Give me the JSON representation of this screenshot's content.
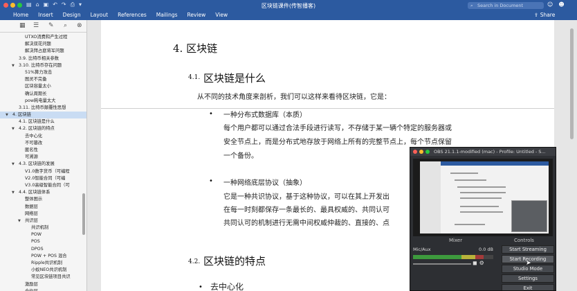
{
  "window": {
    "title": "区块链课件(传智播客)",
    "search_placeholder": "Search in Document",
    "toolbar_icons": [
      "sidebar-icon",
      "home-icon",
      "save-icon",
      "undo-icon",
      "redo-icon",
      "print-icon",
      "more-icon"
    ]
  },
  "ribbon": {
    "tabs": [
      "Home",
      "Insert",
      "Design",
      "Layout",
      "References",
      "Mailings",
      "Review",
      "View"
    ],
    "share": "Share"
  },
  "navigation": {
    "items": [
      {
        "text": "UTXO消费和产生过程",
        "indent": 36,
        "caret": ""
      },
      {
        "text": "解决双花问题",
        "indent": 36,
        "caret": ""
      },
      {
        "text": "解决拜占庭将军问题",
        "indent": 36,
        "caret": ""
      },
      {
        "text": "3.9. 比特币相关参数",
        "indent": 27,
        "caret": ""
      },
      {
        "text": "3.10. 比特币存在问题",
        "indent": 27,
        "caret": "▼"
      },
      {
        "text": "51%算力攻击",
        "indent": 36,
        "caret": ""
      },
      {
        "text": "图灵不完备",
        "indent": 36,
        "caret": ""
      },
      {
        "text": "区块容量太小",
        "indent": 36,
        "caret": ""
      },
      {
        "text": "确认周期长",
        "indent": 36,
        "caret": ""
      },
      {
        "text": "pow耗电量太大",
        "indent": 36,
        "caret": ""
      },
      {
        "text": "3.11. 比特币颠覆性思想",
        "indent": 27,
        "caret": ""
      },
      {
        "text": "4. 区块链",
        "indent": 18,
        "caret": "▼",
        "selected": true
      },
      {
        "text": "4.1. 区块链是什么",
        "indent": 27,
        "caret": ""
      },
      {
        "text": "4.2. 区块链的特点",
        "indent": 27,
        "caret": "▼"
      },
      {
        "text": "去中心化",
        "indent": 36,
        "caret": ""
      },
      {
        "text": "不可篡改",
        "indent": 36,
        "caret": ""
      },
      {
        "text": "匿名性",
        "indent": 36,
        "caret": ""
      },
      {
        "text": "可溯源",
        "indent": 36,
        "caret": ""
      },
      {
        "text": "4.3. 区块链的发展",
        "indent": 27,
        "caret": "▼"
      },
      {
        "text": "V1.0数字货币（可编程",
        "indent": 36,
        "caret": ""
      },
      {
        "text": "V2.0智能合同（可编",
        "indent": 36,
        "caret": ""
      },
      {
        "text": "V3.0高级智能合同（可",
        "indent": 36,
        "caret": ""
      },
      {
        "text": "4.4. 区块链体系",
        "indent": 27,
        "caret": "▼"
      },
      {
        "text": "整体图示",
        "indent": 36,
        "caret": ""
      },
      {
        "text": "数据层",
        "indent": 36,
        "caret": ""
      },
      {
        "text": "网络层",
        "indent": 36,
        "caret": ""
      },
      {
        "text": "共识层",
        "indent": 36,
        "caret": "▼"
      },
      {
        "text": "共识机制",
        "indent": 45,
        "caret": ""
      },
      {
        "text": "POW",
        "indent": 45,
        "caret": ""
      },
      {
        "text": "POS",
        "indent": 45,
        "caret": ""
      },
      {
        "text": "DPOS",
        "indent": 45,
        "caret": ""
      },
      {
        "text": "POW + POS 混合",
        "indent": 45,
        "caret": ""
      },
      {
        "text": "Ripple共识机制",
        "indent": 45,
        "caret": ""
      },
      {
        "text": "小蚁NEO共识机制",
        "indent": 45,
        "caret": ""
      },
      {
        "text": "常见区块链项目共识",
        "indent": 45,
        "caret": ""
      },
      {
        "text": "激励层",
        "indent": 36,
        "caret": ""
      },
      {
        "text": "合约层",
        "indent": 36,
        "caret": ""
      }
    ]
  },
  "document": {
    "h_chapter": "4.  区块链",
    "h_41_num": "4.1.",
    "h_41_text": "区块链是什么",
    "intro": "从不同的技术角度来剖析，我们可以这样来看待区块链，它是：",
    "b1_title": "一种分布式数据库（本质）",
    "b1_line1": "每个用户都可以通过合法手段进行读写，不存储于某一辆个特定的服务器或",
    "b1_line2": "安全节点上，而是分布式地存放于网络上所有的完整节点上，每个节点保留",
    "b1_line3": "一个备份。",
    "b2_title": "一种网络底层协议（抽象）",
    "b2_line1": "它是一种共识协议，基于这种协议，可以在其上开发出",
    "b2_line2": "在每一时刻都保存一条最长的、最具权威的、共同认可",
    "b2_line3": "共同认可的机制进行无需中间权威仲裁的、直接的、点",
    "h_42_num": "4.2.",
    "h_42_text": "区块链的特点",
    "b3_title": "去中心化"
  },
  "obs": {
    "title": "OBS 21.1.1-modified (mac) - Profile: Untitled - S...",
    "mixer_label": "Mixer",
    "controls_label": "Controls",
    "source_name": "Mic/Aux",
    "level": "0.0 dB",
    "buttons": [
      "Start Streaming",
      "Start Recording",
      "Studio Mode",
      "Settings",
      "Exit"
    ]
  }
}
